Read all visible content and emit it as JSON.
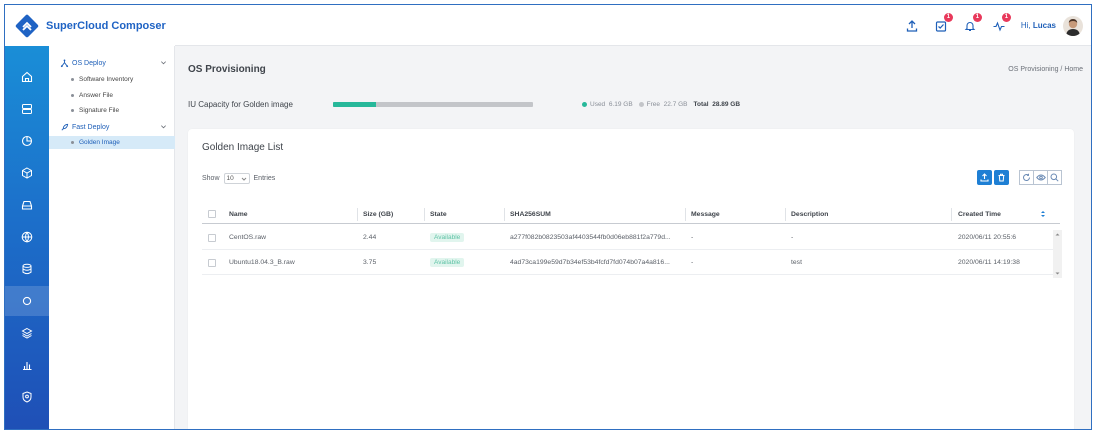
{
  "app": {
    "title": "SuperCloud Composer"
  },
  "header": {
    "greeting_prefix": "Hi,",
    "user": "Lucas",
    "badges": {
      "tasks": "1",
      "alerts": "1",
      "activity": "1"
    }
  },
  "rail_icons": [
    "home-icon",
    "servers-icon",
    "chart-pie-icon",
    "cube-icon",
    "drive-icon",
    "globe-icon",
    "database-icon",
    "circle-icon",
    "layers-icon",
    "bar-chart-icon",
    "shield-icon"
  ],
  "tree": {
    "groups": [
      {
        "label": "OS Deploy",
        "items": [
          "Software Inventory",
          "Answer File",
          "Signature File"
        ]
      },
      {
        "label": "Fast Deploy",
        "items": [
          "Golden Image"
        ]
      }
    ],
    "active": "Golden Image"
  },
  "page": {
    "title": "OS Provisioning",
    "breadcrumb": "OS Provisioning / Home",
    "capacity": {
      "label": "IU Capacity for Golden image",
      "used_label": "Used",
      "used": "6.19 GB",
      "free_label": "Free",
      "free": "22.7 GB",
      "total_label": "Total",
      "total": "28.89 GB",
      "used_fraction": 0.214,
      "used_color": "#27b89a",
      "free_color": "#c3c5c9"
    }
  },
  "list": {
    "title": "Golden Image List",
    "show_label": "Show",
    "page_size": "10",
    "entries_label": "Entries",
    "columns": [
      "Name",
      "Size (GB)",
      "State",
      "SHA256SUM",
      "Message",
      "Description",
      "Created Time"
    ],
    "rows": [
      {
        "name": "CentOS.raw",
        "size": "2.44",
        "state": "Available",
        "sha": "a277f082b0823503af4403544fb0d06eb881f2a779d...",
        "message": "-",
        "description": "-",
        "created": "2020/06/11 20:55:6"
      },
      {
        "name": "Ubuntu18.04.3_B.raw",
        "size": "3.75",
        "state": "Available",
        "sha": "4ad73ca199e59d7b34ef53b4fcfd7fd074b07a4a816...",
        "message": "-",
        "description": "test",
        "created": "2020/06/11 14:19:38"
      }
    ],
    "accent": "#1e7fd4"
  }
}
